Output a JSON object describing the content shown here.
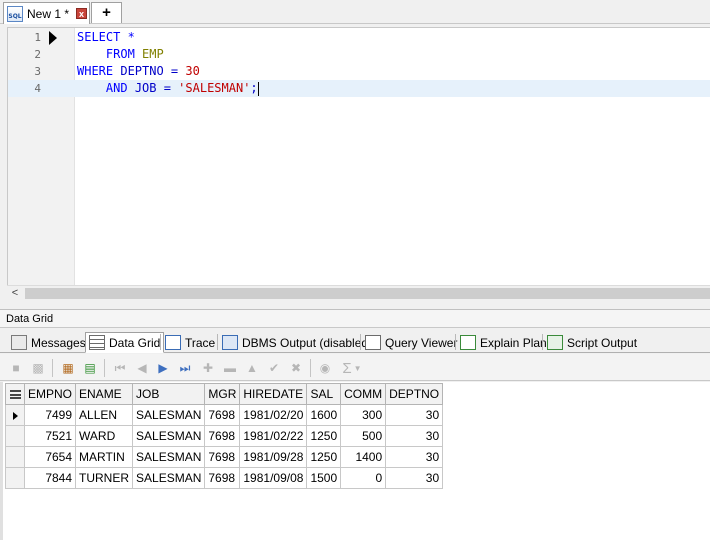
{
  "tabs": {
    "doc_tab_icon_text": "SQL",
    "doc_tab_label": "New 1 *",
    "close_glyph": "x",
    "new_tab_glyph": "+"
  },
  "editor": {
    "lines": [
      {
        "num": "1"
      },
      {
        "num": "2"
      },
      {
        "num": "3"
      },
      {
        "num": "4"
      }
    ],
    "tokens": {
      "l1_select": "SELECT",
      "l1_star": " *",
      "l2_indent": "    ",
      "l2_from": "FROM",
      "l2_space": " ",
      "l2_table": "EMP",
      "l3_where": "WHERE",
      "l3_rest": " DEPTNO = ",
      "l3_num": "30",
      "l4_indent": "    ",
      "l4_and": "AND",
      "l4_rest": " JOB = ",
      "l4_str": "'SALESMAN'",
      "l4_semi": ";"
    },
    "current_line": 4
  },
  "scrollbar": {
    "left_glyph": "<"
  },
  "panel": {
    "title": "Data Grid"
  },
  "result_tabs": [
    {
      "label": "Messages",
      "icon": "messages-icon"
    },
    {
      "label": "Data Grid",
      "icon": "data-grid-icon",
      "active": true
    },
    {
      "label": "Trace",
      "icon": "trace-icon"
    },
    {
      "label": "DBMS Output (disabled)",
      "icon": "dbms-output-icon"
    },
    {
      "label": "Query Viewer",
      "icon": "query-viewer-icon"
    },
    {
      "label": "Explain Plan",
      "icon": "explain-plan-icon"
    },
    {
      "label": "Script Output",
      "icon": "script-output-icon"
    }
  ],
  "grid_toolbar": {
    "icons": [
      "export-icon",
      "print-icon",
      "grid-settings-icon",
      "record-view-icon",
      "first-record-icon",
      "prior-record-icon",
      "next-record-icon",
      "last-record-icon",
      "insert-record-icon",
      "delete-record-icon",
      "edit-record-icon",
      "post-edit-icon",
      "cancel-edit-icon",
      "aggregate-icon"
    ],
    "sum_glyph": "Σ"
  },
  "grid": {
    "columns": [
      "EMPNO",
      "ENAME",
      "JOB",
      "MGR",
      "HIREDATE",
      "SAL",
      "COMM",
      "DEPTNO"
    ],
    "rows": [
      [
        "7499",
        "ALLEN",
        "SALESMAN",
        "7698",
        "1981/02/20",
        "1600",
        "300",
        "30"
      ],
      [
        "7521",
        "WARD",
        "SALESMAN",
        "7698",
        "1981/02/22",
        "1250",
        "500",
        "30"
      ],
      [
        "7654",
        "MARTIN",
        "SALESMAN",
        "7698",
        "1981/09/28",
        "1250",
        "1400",
        "30"
      ],
      [
        "7844",
        "TURNER",
        "SALESMAN",
        "7698",
        "1981/09/08",
        "1500",
        "0",
        "30"
      ]
    ],
    "current_row": 0
  },
  "colors": {
    "keyword": "#0000ff",
    "string": "#c00000",
    "table_name": "#808000",
    "current_line_bg": "#e6f1fb"
  }
}
